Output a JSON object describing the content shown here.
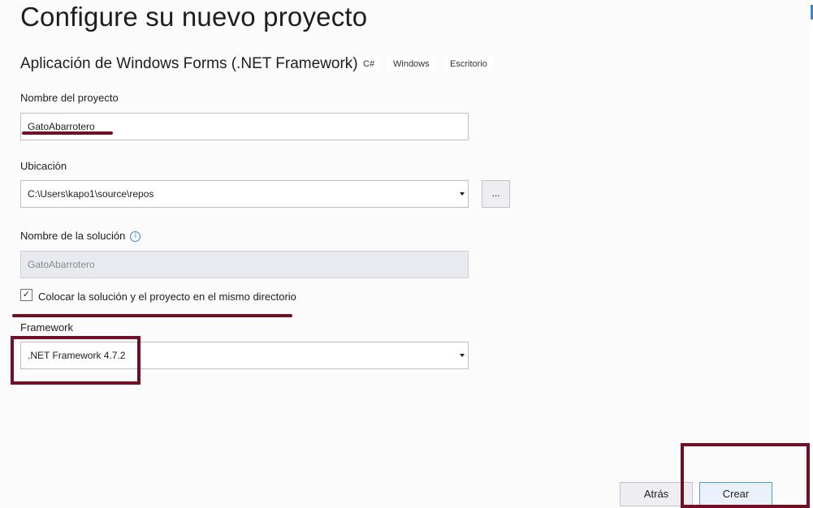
{
  "header": {
    "title": "Configure su nuevo proyecto",
    "template_name": "Aplicación de Windows Forms (.NET Framework)",
    "tags": [
      "C#",
      "Windows",
      "Escritorio"
    ]
  },
  "form": {
    "project_name": {
      "label": "Nombre del proyecto",
      "value": "GatoAbarrotero"
    },
    "location": {
      "label": "Ubicación",
      "value": "C:\\Users\\kapo1\\source\\repos",
      "browse_label": "..."
    },
    "solution_name": {
      "label": "Nombre de la solución",
      "value": "GatoAbarrotero",
      "info_icon": "ⓘ"
    },
    "same_directory": {
      "label": "Colocar la solución y el proyecto en el mismo directorio",
      "checked": true,
      "check_mark": "✓"
    },
    "framework": {
      "label": "Framework",
      "value": ".NET Framework 4.7.2"
    }
  },
  "footer": {
    "back_label": "Atrás",
    "create_label": "Crear"
  },
  "colors": {
    "annotation": "#720f24",
    "accent_border": "#4e9ede",
    "background": "#fbfbfc"
  },
  "icons": {
    "info": "info-icon",
    "dropdown": "chevron-down-icon",
    "checkbox": "check-icon"
  }
}
